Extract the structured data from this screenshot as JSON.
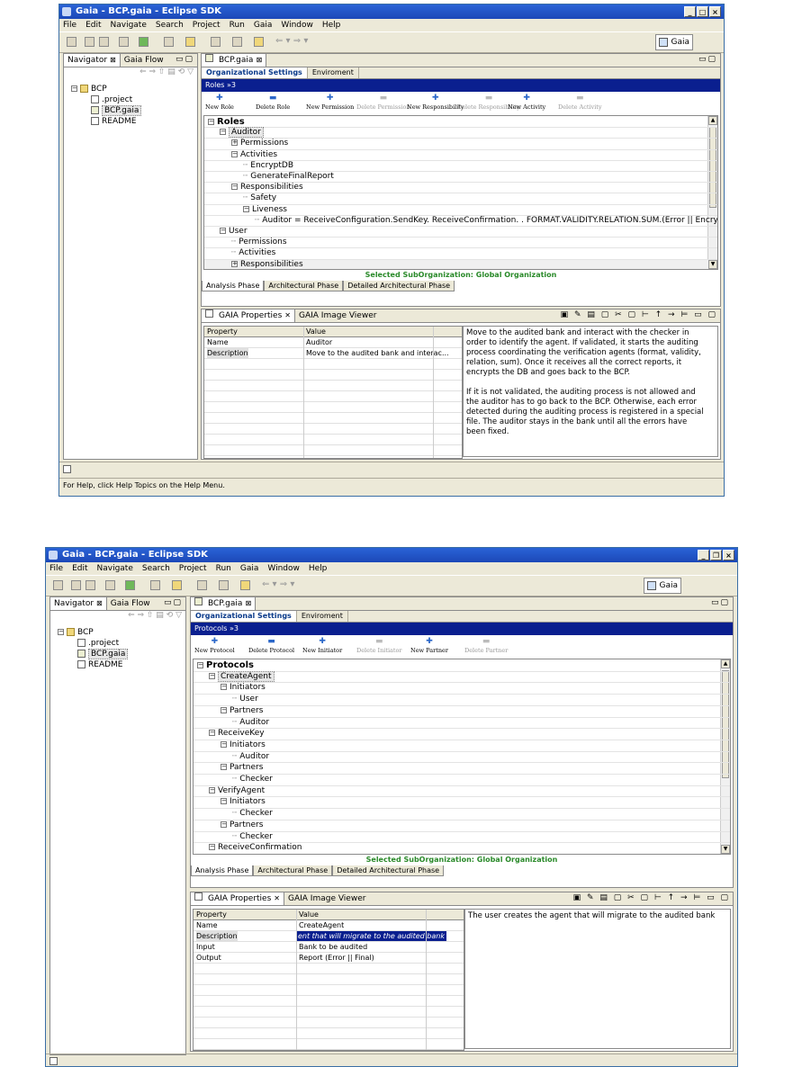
{
  "shared": {
    "title": "Gaia - BCP.gaia - Eclipse SDK",
    "menu": [
      "File",
      "Edit",
      "Navigate",
      "Search",
      "Project",
      "Run",
      "Gaia",
      "Window",
      "Help"
    ],
    "perspective": "Gaia",
    "navigator_tab": "Navigator",
    "gaiaflow_tab": "Gaia Flow",
    "nav_tree": [
      "BCP",
      ".project",
      "BCP.gaia",
      "README"
    ],
    "editor_tab": "BCP.gaia",
    "top_tabs": [
      "Organizational Settings",
      "Enviroment"
    ],
    "bottom_tabs": [
      "Analysis Phase",
      "Architectural Phase",
      "Detailed Architectural Phase"
    ],
    "suborg": "Selected SubOrganization: Global Organization",
    "props_tab": "GAIA Properties",
    "image_tab": "GAIA Image Viewer",
    "col_property": "Property",
    "col_value": "Value"
  },
  "win1": {
    "breadcrumb": "Roles  »3",
    "actions": [
      {
        "label": "New Role",
        "enabled": true,
        "icon": "plus"
      },
      {
        "label": "Delete Role",
        "enabled": true,
        "icon": "minus"
      },
      {
        "label": "New Permission",
        "enabled": true,
        "icon": "plus"
      },
      {
        "label": "Delete Permission",
        "enabled": false,
        "icon": "minus"
      },
      {
        "label": "New Responsibility",
        "enabled": true,
        "icon": "plus"
      },
      {
        "label": "Delete Responsibility",
        "enabled": false,
        "icon": "minus"
      },
      {
        "label": "New Activity",
        "enabled": true,
        "icon": "plus"
      },
      {
        "label": "Delete Activity",
        "enabled": false,
        "icon": "minus"
      }
    ],
    "tree": [
      {
        "label": "Roles",
        "level": 0,
        "box": "-",
        "bold": true
      },
      {
        "label": "Auditor",
        "level": 1,
        "box": "-",
        "hl": true
      },
      {
        "label": "Permissions",
        "level": 2,
        "box": "+"
      },
      {
        "label": "Activities",
        "level": 2,
        "box": "-"
      },
      {
        "label": "EncryptDB",
        "level": 3,
        "box": ""
      },
      {
        "label": "GenerateFinalReport",
        "level": 3,
        "box": ""
      },
      {
        "label": "Responsibilities",
        "level": 2,
        "box": "-"
      },
      {
        "label": "Safety",
        "level": 3,
        "box": ""
      },
      {
        "label": "Liveness",
        "level": 3,
        "box": "-"
      },
      {
        "label": "Auditor = ReceiveConfiguration.SendKey. ReceiveConfirmation. . FORMAT.VALIDITY.RELATION.SUM.(Error || EncryptDB. GenerarFinalReport",
        "level": 4,
        "box": ""
      },
      {
        "label": "User",
        "level": 1,
        "box": "-"
      },
      {
        "label": "Permissions",
        "level": 2,
        "box": ""
      },
      {
        "label": "Activities",
        "level": 2,
        "box": ""
      },
      {
        "label": "Responsibilities",
        "level": 2,
        "box": "+"
      }
    ],
    "props": [
      {
        "name": "Name",
        "value": "Auditor"
      },
      {
        "name": "Description",
        "value": "Move to the audited bank and interac...",
        "sel": true
      }
    ],
    "description": "Move to the audited bank and interact with the checker in order to identify the agent. If validated, it starts the auditing process coordinating the verification agents (format, validity, relation, sum). Once it receives all the correct reports, it encrypts the DB and goes back to the BCP.\n\nIf it is not validated, the auditing process is not allowed and the auditor has to go back to the BCP. Otherwise, each error detected during the auditing process is registered in a special file. The auditor stays in the bank until all the errors have been fixed.",
    "helpstatus": "For Help, click Help Topics on the Help Menu."
  },
  "win2": {
    "breadcrumb": "Protocols  »3",
    "actions": [
      {
        "label": "New Protocol",
        "enabled": true,
        "icon": "plus"
      },
      {
        "label": "Delete Protocol",
        "enabled": true,
        "icon": "minus"
      },
      {
        "label": "New Initiator",
        "enabled": true,
        "icon": "plus"
      },
      {
        "label": "Delete Initiator",
        "enabled": false,
        "icon": "minus"
      },
      {
        "label": "New Partner",
        "enabled": true,
        "icon": "plus"
      },
      {
        "label": "Delete Partner",
        "enabled": false,
        "icon": "minus"
      }
    ],
    "tree": [
      {
        "label": "Protocols",
        "level": 0,
        "box": "-",
        "bold": true
      },
      {
        "label": "CreateAgent",
        "level": 1,
        "box": "-",
        "hl": true
      },
      {
        "label": "Initiators",
        "level": 2,
        "box": "-"
      },
      {
        "label": "User",
        "level": 3,
        "box": ""
      },
      {
        "label": "Partners",
        "level": 2,
        "box": "-"
      },
      {
        "label": "Auditor",
        "level": 3,
        "box": ""
      },
      {
        "label": "ReceiveKey",
        "level": 1,
        "box": "-"
      },
      {
        "label": "Initiators",
        "level": 2,
        "box": "-"
      },
      {
        "label": "Auditor",
        "level": 3,
        "box": ""
      },
      {
        "label": "Partners",
        "level": 2,
        "box": "-"
      },
      {
        "label": "Checker",
        "level": 3,
        "box": ""
      },
      {
        "label": "VerifyAgent",
        "level": 1,
        "box": "-"
      },
      {
        "label": "Initiators",
        "level": 2,
        "box": "-"
      },
      {
        "label": "Checker",
        "level": 3,
        "box": ""
      },
      {
        "label": "Partners",
        "level": 2,
        "box": "-"
      },
      {
        "label": "Checker",
        "level": 3,
        "box": ""
      },
      {
        "label": "ReceiveConfirmation",
        "level": 1,
        "box": "-"
      }
    ],
    "props": [
      {
        "name": "Name",
        "value": "CreateAgent"
      },
      {
        "name": "Description",
        "value": "ent that will migrate to the audited bank",
        "sel": true,
        "editing": true
      },
      {
        "name": "Input",
        "value": "Bank to be audited"
      },
      {
        "name": "Output",
        "value": "Report (Error || Final)"
      }
    ],
    "description": "The user creates the agent that will migrate to the audited bank"
  }
}
